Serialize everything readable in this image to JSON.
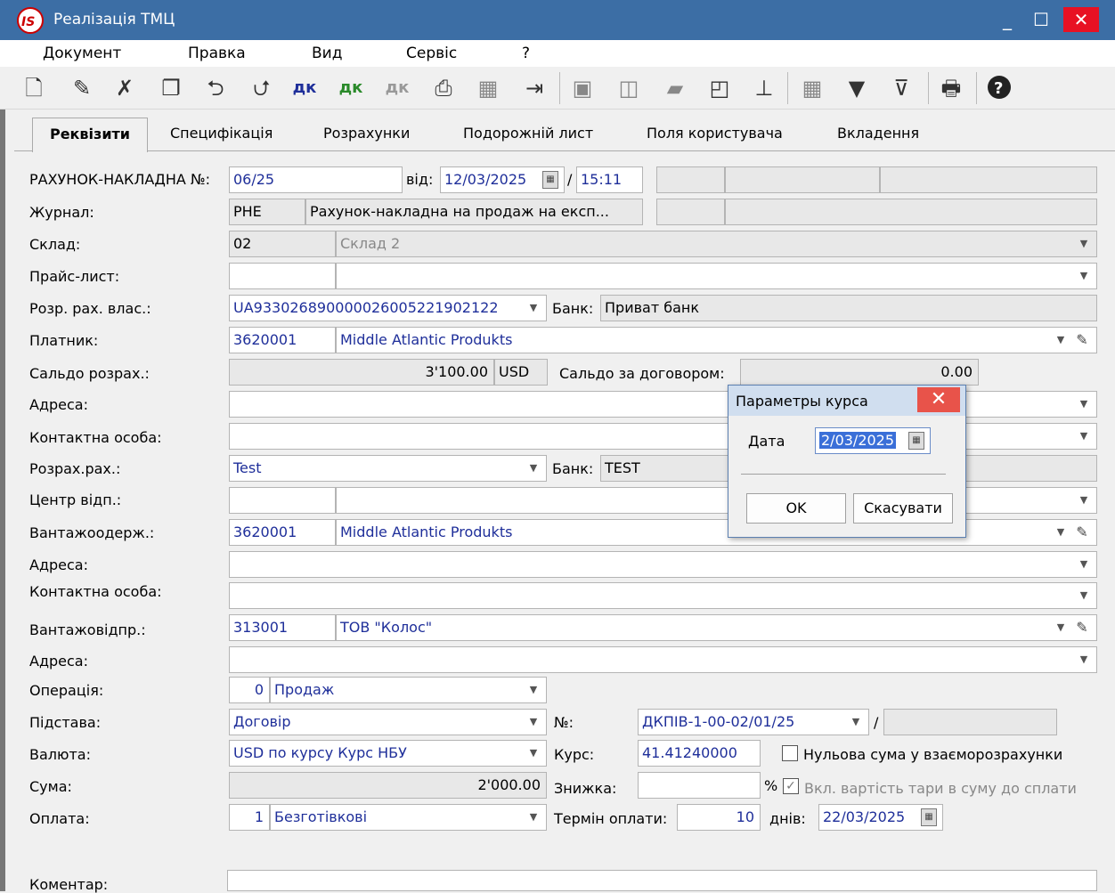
{
  "window": {
    "title": "Реалізація ТМЦ",
    "logo_text": "IS",
    "minimize": "_",
    "maximize": "☐",
    "close": "✕"
  },
  "menu": [
    "Документ",
    "Правка",
    "Вид",
    "Сервіс",
    "?"
  ],
  "toolbar_icons": [
    "new-doc-icon",
    "edit-doc-icon",
    "delete-doc-icon",
    "copy-doc-icon",
    "doc-import-icon",
    "doc-export-icon",
    "dk-icon",
    "dk-green-icon",
    "dk-grey-icon",
    "copy-print-icon",
    "excel-icon",
    "exit-doc-icon",
    "save-icon",
    "book-icon",
    "folder-icon",
    "chat-icon",
    "tree-icon",
    "grid-icon",
    "filter-icon",
    "clear-filter-icon",
    "print-icon",
    "help-icon"
  ],
  "tabs": [
    "Реквізити",
    "Специфікація",
    "Розрахунки",
    "Подорожній лист",
    "Поля користувача",
    "Вкладення"
  ],
  "form": {
    "invoice_label": "РАХУНОК-НАКЛАДНА №:",
    "invoice_no": "06/25",
    "from_label": "від:",
    "date": "12/03/2025",
    "slash": "/",
    "time": "15:11",
    "journal_label": "Журнал:",
    "journal_code": "РНЕ",
    "journal_name": "Рахунок-накладна на продаж на експ...",
    "warehouse_label": "Склад:",
    "warehouse_code": "02",
    "warehouse_name": "Склад 2",
    "pricelist_label": "Прайс-лист:",
    "own_account_label": "Розр. рах. влас.:",
    "own_account": "UA933026890000026005221902122",
    "bank_label": "Банк:",
    "own_bank": "Приват банк",
    "payer_label": "Платник:",
    "payer_code": "3620001",
    "payer_name": "Middle Atlantic Produkts",
    "balance_label": "Сальдо розрах.:",
    "balance": "3'100.00",
    "balance_currency": "USD",
    "contract_balance_label": "Сальдо за договором:",
    "contract_balance": "0.00",
    "address_label": "Адреса:",
    "contact_label": "Контактна особа:",
    "settle_account_label": "Розрах.рах.:",
    "settle_account": "Test",
    "settle_bank": "TEST",
    "center_label": "Центр відп.:",
    "consignee_label": "Вантажоодерж.:",
    "consignee_code": "3620001",
    "consignee_name": "Middle Atlantic Produkts",
    "shipper_label": "Вантажовідпр.:",
    "shipper_code": "313001",
    "shipper_name": "ТОВ \"Колос\"",
    "operation_label": "Операція:",
    "operation_code": "0",
    "operation_name": "Продаж",
    "basis_label": "Підстава:",
    "basis": "Договір",
    "no_label": "№:",
    "contract_no": "ДКПІВ-1-00-02/01/25",
    "currency_label": "Валюта:",
    "currency": "USD по курсу Курс НБУ",
    "rate_label": "Курс:",
    "rate": "41.41240000",
    "zero_sum_label": "Нульова сума у взаєморозрахунки",
    "sum_label": "Сума:",
    "sum": "2'000.00",
    "discount_label": "Знижка:",
    "percent": "%",
    "tare_label": "Вкл. вартість тари в суму до сплати",
    "payment_label": "Оплата:",
    "payment_code": "1",
    "payment_name": "Безготівкові",
    "term_label": "Термін оплати:",
    "term_days": "10",
    "days_label": "днів:",
    "due_date": "22/03/2025",
    "comment_label": "Коментар:"
  },
  "dialog": {
    "title": "Параметры курса",
    "date_label": "Дата",
    "date_value": "2/03/2025",
    "ok": "OK",
    "cancel": "Скасувати"
  },
  "colors": {
    "titlebar": "#3c6ea5",
    "close": "#e81123",
    "link_text": "#1f2f9a"
  }
}
